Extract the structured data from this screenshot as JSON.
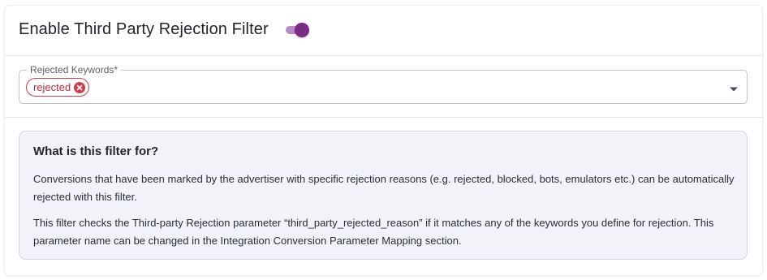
{
  "filter": {
    "title": "Enable Third Party Rejection Filter",
    "toggle_state": "on",
    "toggle_color": "#7a2b88"
  },
  "keywords_field": {
    "label": "Rejected Keywords*",
    "chips": [
      {
        "label": "rejected",
        "remove_icon": "close-circle-icon"
      }
    ],
    "dropdown_icon": "caret-down-icon"
  },
  "info": {
    "title": "What is this filter for?",
    "paragraph_1": "Conversions that have been marked by the advertiser with specific rejection reasons (e.g. rejected, blocked, bots, emulators etc.) can be automatically rejected with this filter.",
    "paragraph_2": "This filter checks the Third-party Rejection parameter “third_party_rejected_reason” if it matches any of the keywords you define for rejection. This parameter name can be changed in the Integration Conversion Parameter Mapping section."
  },
  "colors": {
    "chip_red": "#d23c4c",
    "info_background": "#f1f3f8"
  }
}
